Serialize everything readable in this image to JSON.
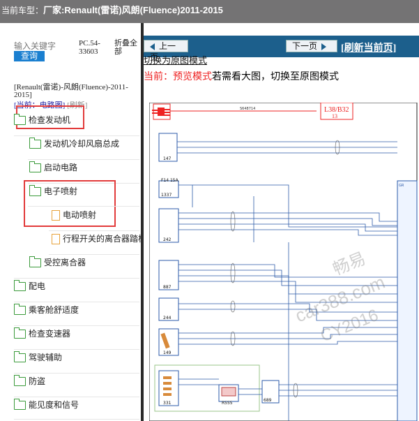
{
  "title_bar": {
    "prefix": "当前车型：",
    "model": "厂家:Renault(雷诺)风朗(Fluence)2011-2015"
  },
  "left_panel": {
    "search_placeholder": "输入关键字",
    "query_button": "查询",
    "pc_code": "PC.54-33603",
    "collapse_all": "折叠全部",
    "vehicle": "[Renault(雷诺)-风朗(Fluence)-2011-2015]",
    "current_label": "[当前：电路图]",
    "refresh_label": "[刷新]",
    "tree": [
      {
        "label": "检查发动机",
        "type": "folder"
      },
      {
        "label": "发动机冷却风扇总成",
        "type": "folder"
      },
      {
        "label": "启动电路",
        "type": "folder"
      },
      {
        "label": "电子喷射",
        "type": "folder"
      },
      {
        "label": "电动喷射",
        "type": "file"
      },
      {
        "label": "行程开关的离合器踏板",
        "type": "file"
      },
      {
        "label": "受控离合器",
        "type": "folder"
      },
      {
        "label": "配电",
        "type": "folder"
      },
      {
        "label": "乘客舱舒适度",
        "type": "folder"
      },
      {
        "label": "检查变速器",
        "type": "folder"
      },
      {
        "label": "驾驶辅助",
        "type": "folder"
      },
      {
        "label": "防盗",
        "type": "folder"
      },
      {
        "label": "能见度和信号",
        "type": "folder"
      }
    ]
  },
  "right_panel": {
    "prev_button": "上一页",
    "next_button": "下一页",
    "refresh_page": "[刷新当前页]",
    "switch_link": "切换为原图模式",
    "mode_prefix": "当前：预览模式",
    "mode_suffix": "若需看大图，切换至原图模式",
    "diagram": {
      "page_label": "L38/B32",
      "page_number": "13",
      "header_code": "S648714",
      "components": [
        "147",
        "1337",
        "242",
        "887",
        "244",
        "149",
        "331",
        "R555",
        "689"
      ],
      "fuse_label": "F14 15A",
      "connector_label": "GR"
    },
    "watermark": {
      "line1": "畅易",
      "line2": "car388.com",
      "line3": "CY2016"
    }
  },
  "colors": {
    "title_bar": "#747374",
    "topbar": "#1c5f8c",
    "highlight": "#e23a3a",
    "folder": "#3a9a3a",
    "file": "#e7a23a"
  }
}
